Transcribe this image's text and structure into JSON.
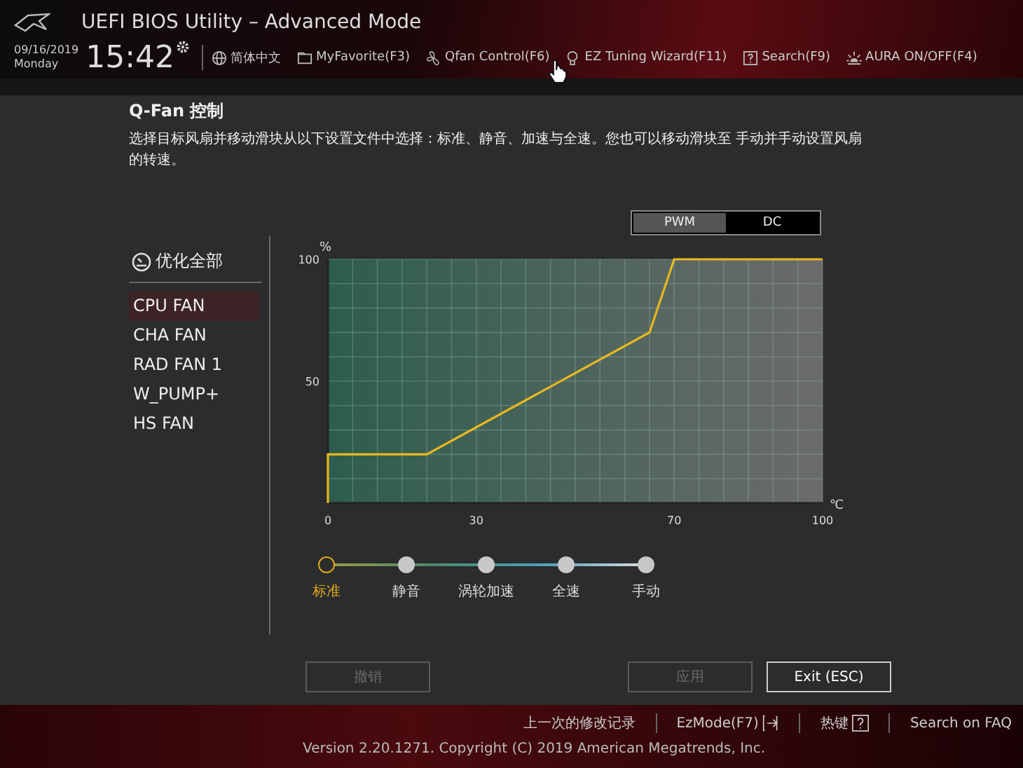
{
  "header": {
    "title": "UEFI BIOS Utility – Advanced Mode",
    "date": "09/16/2019",
    "weekday": "Monday",
    "time": "15:42",
    "toolbar": [
      "简体中文",
      "MyFavorite(F3)",
      "Qfan Control(F6)",
      "EZ Tuning Wizard(F11)",
      "Search(F9)",
      "AURA ON/OFF(F4)"
    ]
  },
  "dialog": {
    "title": "Q-Fan 控制",
    "description": "选择目标风扇并移动滑块从以下设置文件中选择：标准、静音、加速与全速。您也可以移动滑块至 手动并手动设置风扇的转速。",
    "optimize_all": "优化全部",
    "fans": [
      {
        "label": "CPU FAN",
        "selected": true
      },
      {
        "label": "CHA FAN",
        "selected": false
      },
      {
        "label": "RAD FAN 1",
        "selected": false
      },
      {
        "label": "W_PUMP+",
        "selected": false
      },
      {
        "label": "HS FAN",
        "selected": false
      }
    ],
    "modes": [
      {
        "label": "PWM",
        "selected": true
      },
      {
        "label": "DC",
        "selected": false
      }
    ],
    "chart_data": {
      "type": "line",
      "xlabel": "℃",
      "ylabel": "%",
      "x": [
        0,
        0,
        20,
        65,
        70,
        100
      ],
      "series": [
        {
          "color": "#e8b820",
          "values": [
            0,
            20,
            20,
            70,
            100,
            100
          ]
        }
      ],
      "grid": true,
      "xlim": [
        0,
        100
      ],
      "ylim": [
        0,
        100
      ],
      "xticks": [
        0,
        30,
        70,
        100
      ],
      "yticks": [
        50,
        100
      ]
    },
    "profiles": [
      {
        "label": "标准",
        "selected": true
      },
      {
        "label": "静音",
        "selected": false
      },
      {
        "label": "涡轮加速",
        "selected": false
      },
      {
        "label": "全速",
        "selected": false
      },
      {
        "label": "手动",
        "selected": false
      }
    ],
    "buttons": [
      {
        "label": "撤销",
        "disabled": true
      },
      {
        "label": "应用",
        "disabled": true
      },
      {
        "label": "Exit (ESC)",
        "disabled": false
      }
    ]
  },
  "footer": {
    "links": [
      "上一次的修改记录",
      "EzMode(F7)",
      "热键",
      "Search on FAQ"
    ],
    "version": "Version 2.20.1271. Copyright (C) 2019 American Megatrends, Inc."
  }
}
